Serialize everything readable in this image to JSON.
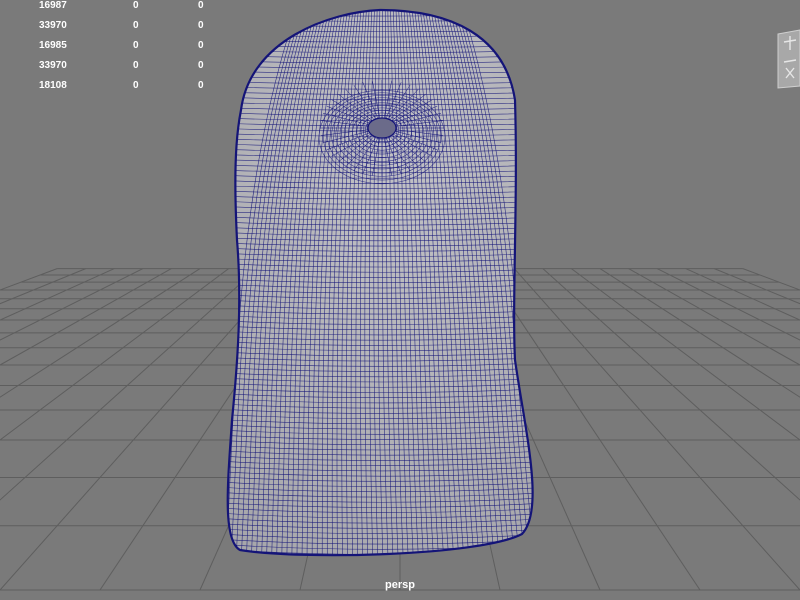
{
  "viewport": {
    "camera_label": "persp",
    "background_color": "#7a7a7a",
    "grid_color": "#5e5e5e",
    "mesh_fill_color": "#b4b4b8",
    "wire_color": "#141478"
  },
  "hud": {
    "rows": [
      {
        "values": [
          "16987",
          "0",
          "0"
        ]
      },
      {
        "values": [
          "33970",
          "0",
          "0"
        ]
      },
      {
        "values": [
          "16985",
          "0",
          "0"
        ]
      },
      {
        "values": [
          "33970",
          "0",
          "0"
        ]
      },
      {
        "values": [
          "18108",
          "0",
          "0"
        ]
      }
    ]
  },
  "view_cube": {
    "icon": "view-cube-icon"
  }
}
